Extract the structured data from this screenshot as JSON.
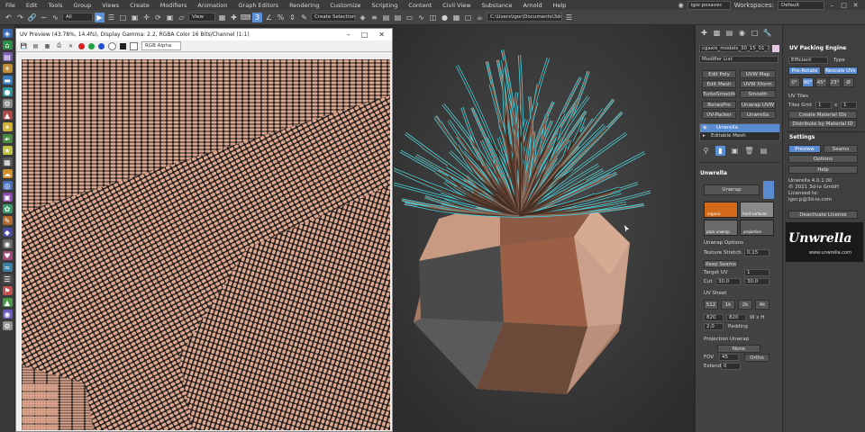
{
  "menu": [
    "File",
    "Edit",
    "Tools",
    "Group",
    "Views",
    "Create",
    "Modifiers",
    "Animation",
    "Graph Editors",
    "Rendering",
    "Customize",
    "Scripting",
    "Content",
    "Civil View",
    "Substance",
    "Arnold",
    "Help"
  ],
  "user": "igor.posavec",
  "workspaces_label": "Workspaces:",
  "workspace": "Default",
  "toolbar": {
    "selection_filter": "All",
    "view": "View",
    "create_selection_set": "Create Selection Se",
    "project_path": "C:\\Users\\igor\\Documents\\3ds Max 2022"
  },
  "uv_window": {
    "title": "UV Preview (43.78%, 14.4fs), Display Gamma: 2.2, RGBA Color 16 Bits/Channel (1:1)",
    "channel": "RGB Alpha",
    "colors": {
      "bg": "#1c1c1c",
      "cells": "#dfa68e"
    }
  },
  "command_panel": {
    "object_name": "cgaxis_models_30_15_01_1",
    "modifier_list": "Modifier List",
    "buttons": [
      "Edit Poly",
      "UVW Map",
      "Edit Mesh",
      "UVW Xform",
      "TurboSmooth",
      "Smooth",
      "BonesPro",
      "Unwrap UVW",
      "UV-Packer",
      "Unwrella"
    ],
    "stack": [
      "Unwrella",
      "Editable Mesh"
    ],
    "rollout_title": "Unwrella",
    "unwrap_button": "Unwrap",
    "presets": [
      "organic",
      "hard surfaces",
      "pack unwrap",
      "projection"
    ],
    "unwrap_options_title": "Unwrap Options",
    "texture_stretch_label": "Texture Stretch",
    "texture_stretch": "0,15",
    "keep_seams": "Keep Seams",
    "target_uv_label": "Target UV",
    "target_uv": "1",
    "cut_label": "Cut",
    "cut_values": [
      "30,0",
      "30,0"
    ],
    "uv_sheet_title": "UV Sheet",
    "sheet_sizes": [
      "512",
      "1k",
      "2k",
      "4k"
    ],
    "sheet_w": "820",
    "sheet_h": "820",
    "wxh": "W x H",
    "padding_value": "2,0",
    "padding_label": "Padding",
    "projection_title": "Projection Unwrap",
    "projection_mode": "None",
    "fov_label": "FOV",
    "fov_value": "45",
    "ortho": "Ortho",
    "extend_label": "Extend",
    "extend_value": "0"
  },
  "unwrella_panel": {
    "title": "UV Packing Engine",
    "engine": "Efficient",
    "type_label": "Type",
    "pre_rotate": "Pre-Rotate",
    "rescale_uvs": "Rescale UVs",
    "angles": [
      "0°",
      "90°",
      "45°",
      "23°",
      "Ø"
    ],
    "uv_tiles_title": "UV Tiles",
    "tiles_grid_label": "Tiles Grid",
    "tiles_x": "1",
    "tiles_y": "1",
    "tiles_x_sep": "x",
    "create_material_ids": "Create Material IDs",
    "distribute_by_material": "Distribute by Material ID",
    "settings_title": "Settings",
    "preview": "Preview",
    "seams": "Seams",
    "options": "Options",
    "help": "Help",
    "version": "Unwrella 4.0.1.00",
    "copyright": "© 2021 3d-io GmbH",
    "licensed_to": "Licensed to:",
    "licensee": "igor.p@3d-io.com",
    "deactivate": "Deactivate License",
    "logo": "Unwrella",
    "url": "www.unwrella.com"
  }
}
